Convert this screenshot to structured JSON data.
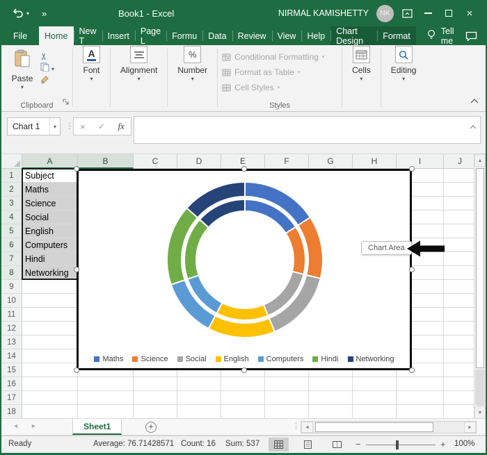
{
  "titlebar": {
    "title": "Book1 - Excel",
    "user_name": "NIRMAL KAMISHETTY",
    "avatar_initials": "NK"
  },
  "tab_bar": {
    "file_label": "File",
    "tabs": [
      {
        "label": "Home",
        "state": "selected"
      },
      {
        "label": "New T",
        "state": "normal"
      },
      {
        "label": "Insert",
        "state": "normal"
      },
      {
        "label": "Page L",
        "state": "normal"
      },
      {
        "label": "Formu",
        "state": "normal"
      },
      {
        "label": "Data",
        "state": "normal"
      },
      {
        "label": "Review",
        "state": "normal"
      },
      {
        "label": "View",
        "state": "normal"
      },
      {
        "label": "Help",
        "state": "normal"
      },
      {
        "label": "Chart Design",
        "state": "contextual"
      },
      {
        "label": "Format",
        "state": "contextual"
      }
    ],
    "tell_me_label": "Tell me"
  },
  "ribbon": {
    "paste_label": "Paste",
    "clipboard_group_label": "Clipboard",
    "font_label": "Font",
    "alignment_label": "Alignment",
    "number_label": "Number",
    "styles_items": [
      "Conditional Formatting",
      "Format as Table",
      "Cell Styles"
    ],
    "styles_group_label": "Styles",
    "cells_label": "Cells",
    "editing_label": "Editing"
  },
  "formula_bar": {
    "name_box_value": "Chart 1",
    "formula_value": ""
  },
  "grid": {
    "column_headers": [
      "A",
      "B",
      "C",
      "D",
      "E",
      "F",
      "G",
      "H",
      "I",
      "J"
    ],
    "selected_columns": [
      "A",
      "B"
    ],
    "row_count": 18,
    "column_a_values": [
      "Subject",
      "Maths",
      "Science",
      "Social",
      "English",
      "Computers",
      "Hindi",
      "Networking"
    ]
  },
  "chart": {
    "tooltip_label": "Chart Area"
  },
  "chart_data": {
    "type": "doughnut",
    "categories": [
      "Maths",
      "Science",
      "Social",
      "English",
      "Computers",
      "Hindi",
      "Networking"
    ],
    "series": [
      {
        "name": "inner ring",
        "values": [
          85,
          70,
          80,
          75,
          65,
          90,
          72
        ]
      },
      {
        "name": "outer ring",
        "values": [
          85,
          70,
          80,
          75,
          65,
          90,
          72
        ]
      }
    ],
    "colors": [
      "#4472C4",
      "#ED7D31",
      "#A5A5A5",
      "#FFC000",
      "#5B9BD5",
      "#70AD47",
      "#264478"
    ],
    "legend_position": "bottom",
    "start_angle_deg": 0
  },
  "sheet_bar": {
    "active_sheet": "Sheet1"
  },
  "status_bar": {
    "mode": "Ready",
    "average": "Average: 76.71428571",
    "count": "Count: 16",
    "sum": "Sum: 537",
    "zoom_level": "100%"
  }
}
